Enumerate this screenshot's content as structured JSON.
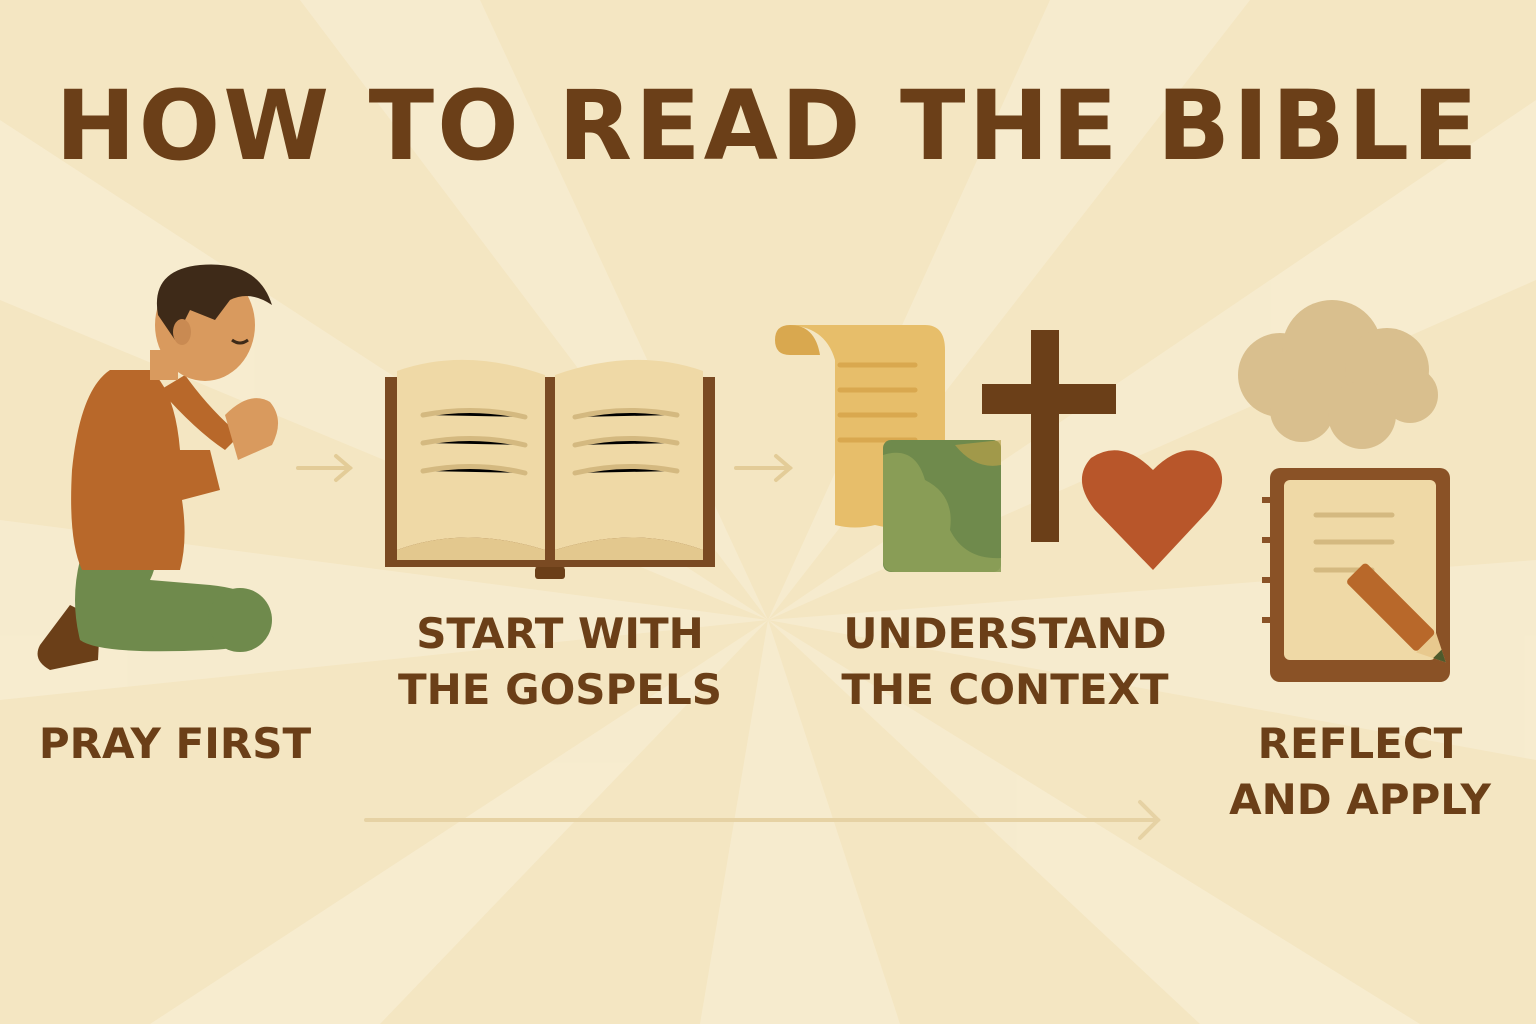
{
  "title": "HOW TO READ THE BIBLE",
  "steps": [
    {
      "id": "pray",
      "lines": [
        "PRAY FIRST"
      ],
      "icon": "praying-person-icon"
    },
    {
      "id": "gospels",
      "lines": [
        "START WITH",
        "THE GOSPELS"
      ],
      "icon": "open-book-icon"
    },
    {
      "id": "context",
      "lines": [
        "UNDERSTAND",
        "THE CONTEXT"
      ],
      "icon": "scroll-map-cross-heart-icon"
    },
    {
      "id": "reflect",
      "lines": [
        "REFLECT",
        "AND APPLY"
      ],
      "icon": "thought-cloud-notebook-icon"
    }
  ],
  "colors": {
    "background": "#f4e6c2",
    "text": "#6b3f18",
    "book_brown": "#7a4a22",
    "page": "#efd9a6",
    "shirt": "#b8682a",
    "pants": "#6f8a4c",
    "heart": "#b8562a",
    "cross": "#6b3f18",
    "arrow": "#e6cf9e"
  }
}
